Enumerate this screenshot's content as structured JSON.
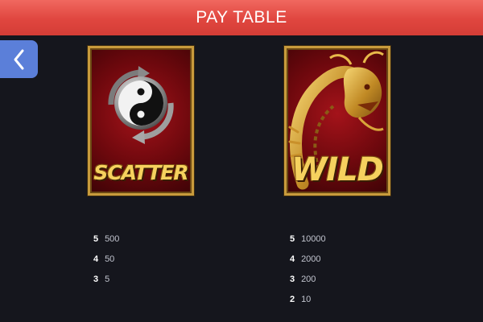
{
  "header": {
    "title": "PAY TABLE"
  },
  "navigation": {
    "back_icon": "chevron-left-icon"
  },
  "symbols": [
    {
      "name": "SCATTER",
      "icon": "yin-yang-icon",
      "payouts": [
        {
          "count": "5",
          "amount": "500"
        },
        {
          "count": "4",
          "amount": "50"
        },
        {
          "count": "3",
          "amount": "5"
        }
      ]
    },
    {
      "name": "WILD",
      "icon": "dragon-icon",
      "payouts": [
        {
          "count": "5",
          "amount": "10000"
        },
        {
          "count": "4",
          "amount": "2000"
        },
        {
          "count": "3",
          "amount": "200"
        },
        {
          "count": "2",
          "amount": "10"
        }
      ]
    }
  ],
  "colors": {
    "background": "#15161d",
    "header": "#e0463f",
    "back_button": "#5b7fd9",
    "symbol_frame": "#c89b3c",
    "symbol_label": "#f6d15e"
  }
}
